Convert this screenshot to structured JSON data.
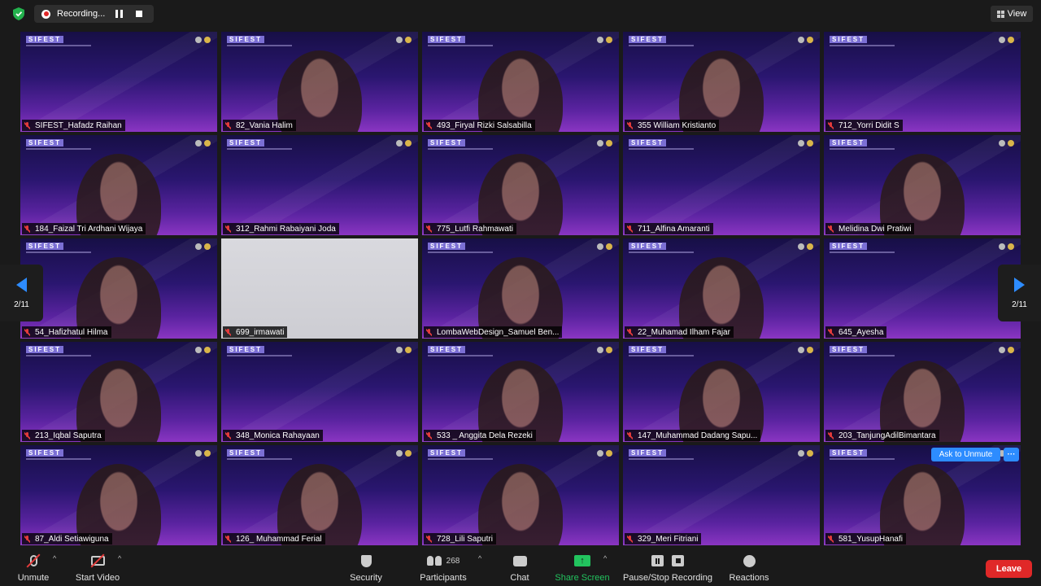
{
  "top_bar": {
    "recording_label": "Recording...",
    "view_label": "View"
  },
  "gallery": {
    "participants": [
      {
        "name": "SIFEST_Hafadz Raihan",
        "video": false
      },
      {
        "name": "82_Vania Halim",
        "video": true
      },
      {
        "name": "493_Firyal Rizki Salsabilla",
        "video": true
      },
      {
        "name": "355 William Kristianto",
        "video": true
      },
      {
        "name": "712_Yorri Didit S",
        "video": false
      },
      {
        "name": "184_Faizal Tri Ardhani Wijaya",
        "video": true
      },
      {
        "name": "312_Rahmi Rabaiyani Joda",
        "video": false
      },
      {
        "name": "775_Lutfi Rahmawati",
        "video": true
      },
      {
        "name": "711_Alfina Amaranti",
        "video": false
      },
      {
        "name": "Melidina Dwi Pratiwi",
        "video": true
      },
      {
        "name": "54_Hafizhatul Hilma",
        "video": true
      },
      {
        "name": "699_irmawati",
        "video": true
      },
      {
        "name": "LombaWebDesign_Samuel Ben...",
        "video": true
      },
      {
        "name": "22_Muhamad Ilham Fajar",
        "video": true
      },
      {
        "name": "645_Ayesha",
        "video": false
      },
      {
        "name": "213_Iqbal Saputra",
        "video": true
      },
      {
        "name": "348_Monica Rahayaan",
        "video": false
      },
      {
        "name": "533 _ Anggita Dela Rezeki",
        "video": true
      },
      {
        "name": "147_Muhammad Dadang Sapu...",
        "video": true
      },
      {
        "name": "203_TanjungAdilBimantara",
        "video": true
      },
      {
        "name": "87_Aldi Setiawiguna",
        "video": true
      },
      {
        "name": "126_ Muhammad Ferial",
        "video": true
      },
      {
        "name": "728_Lili Saputri",
        "video": true
      },
      {
        "name": "329_Meri Fitriani",
        "video": false
      },
      {
        "name": "581_YusupHanafi",
        "video": true
      }
    ],
    "background_logo": "SIFEST",
    "ask_to_unmute_label": "Ask to Unmute",
    "more_label": "···"
  },
  "pager": {
    "page_label": "2/11"
  },
  "toolbar": {
    "unmute_label": "Unmute",
    "start_video_label": "Start Video",
    "security_label": "Security",
    "participants_label": "Participants",
    "participants_count": "268",
    "chat_label": "Chat",
    "share_screen_label": "Share Screen",
    "pause_stop_label": "Pause/Stop Recording",
    "reactions_label": "Reactions",
    "leave_label": "Leave"
  },
  "colors": {
    "accent_blue": "#2d8cff",
    "share_green": "#22c35e",
    "leave_red": "#e02828",
    "background": "#1a1a1a"
  }
}
